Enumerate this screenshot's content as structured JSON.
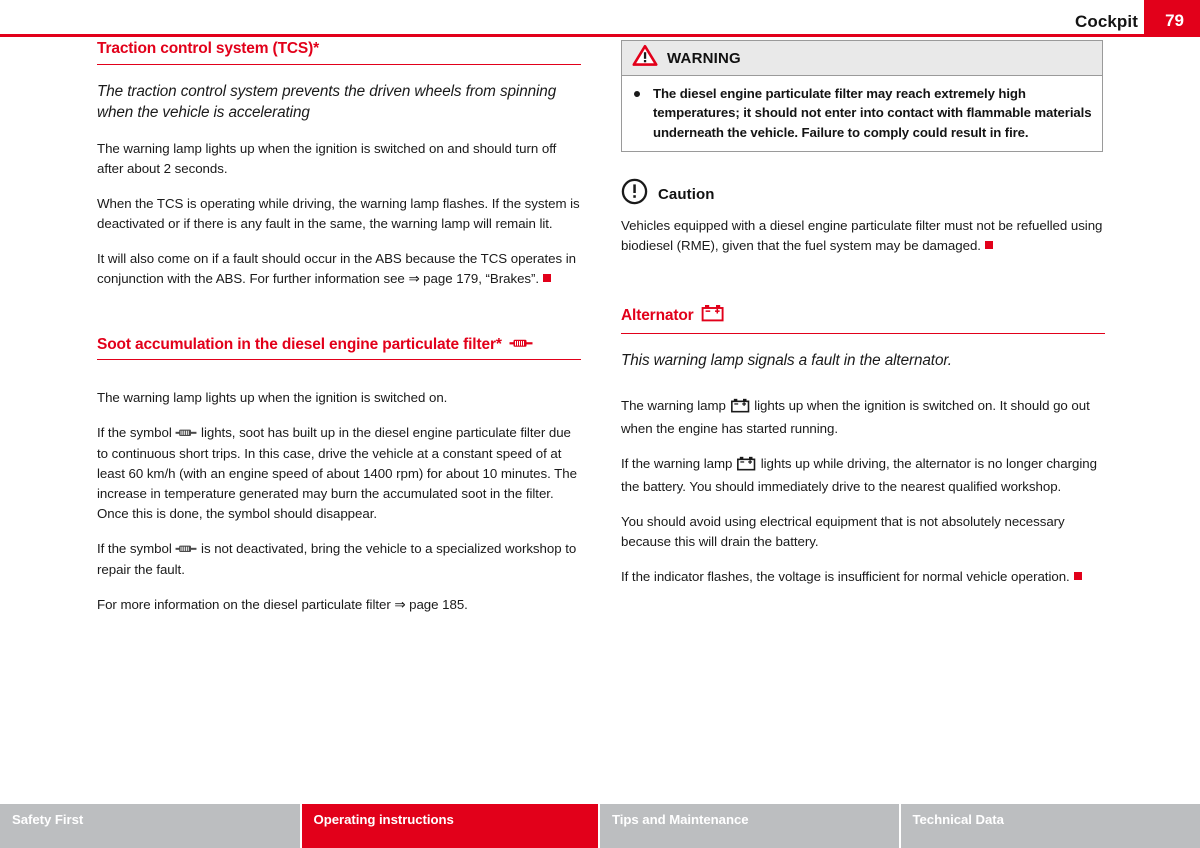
{
  "header": {
    "title": "Cockpit",
    "page_number": "79",
    "accent_color": "#e2001a"
  },
  "left_column": {
    "section1": {
      "heading": "Traction control system (TCS)*",
      "intro": "The traction control system prevents the driven wheels from spinning when the vehicle is accelerating",
      "paragraphs": [
        "The warning lamp lights up when the ignition is switched on and should turn off after about 2 seconds.",
        "When the TCS is operating while driving, the warning lamp flashes. If the system is deactivated or if there is any fault in the same, the warning lamp will remain lit.",
        "It will also come on if a fault should occur in the ABS because the TCS operates in conjunction with the ABS. For further information see"
      ],
      "para3_ref": "⇒ page 179,",
      "para3_tail": "“Brakes”."
    },
    "section2": {
      "heading": "Soot accumulation in the diesel engine particulate filter*",
      "heading_icon": "particulate-filter-icon",
      "p1": "The warning lamp lights up when the ignition is switched on.",
      "p2_pre": "If the symbol",
      "p2_post": "lights, soot has built up in the diesel engine particulate filter due to continuous short trips. In this case, drive the vehicle at a constant speed of at least 60 km/h (with an engine speed of about 1400 rpm) for about 10 minutes. The increase in temperature generated may burn the accumulated soot in the filter. Once this is done, the symbol should disappear.",
      "p3_pre": "If the symbol",
      "p3_post": "is not deactivated, bring the vehicle to a specialized workshop to repair the fault.",
      "p4_pre": "For more information on the diesel particulate filter",
      "p4_ref": "⇒ page 185."
    }
  },
  "right_column": {
    "warning": {
      "label": "WARNING",
      "icon": "warning-triangle-icon",
      "text": "The diesel engine particulate filter may reach extremely high temperatures; it should not enter into contact with flammable materials underneath the vehicle. Failure to comply could result in fire."
    },
    "caution": {
      "label": "Caution",
      "icon": "caution-exclamation-icon",
      "text": "Vehicles equipped with a diesel engine particulate filter must not be refuelled using biodiesel (RME), given that the fuel system may be damaged."
    },
    "section_alternator": {
      "heading": "Alternator",
      "heading_icon": "battery-icon",
      "intro": "This warning lamp signals a fault in the alternator.",
      "p1_pre": "The warning lamp",
      "p1_post": "lights up when the ignition is switched on. It should go out when the engine has started running.",
      "p2_pre": "If the warning lamp",
      "p2_post": "lights up while driving, the alternator is no longer charging the battery. You should immediately drive to the nearest qualified workshop.",
      "p3": "You should avoid using electrical equipment that is not absolutely necessary because this will drain the battery.",
      "p4": "If the indicator flashes, the voltage is insufficient for normal vehicle operation."
    }
  },
  "footer": {
    "tabs": [
      {
        "label": "Safety First",
        "active": false
      },
      {
        "label": "Operating instructions",
        "active": true
      },
      {
        "label": "Tips and Maintenance",
        "active": false
      },
      {
        "label": "Technical Data",
        "active": false
      }
    ]
  }
}
